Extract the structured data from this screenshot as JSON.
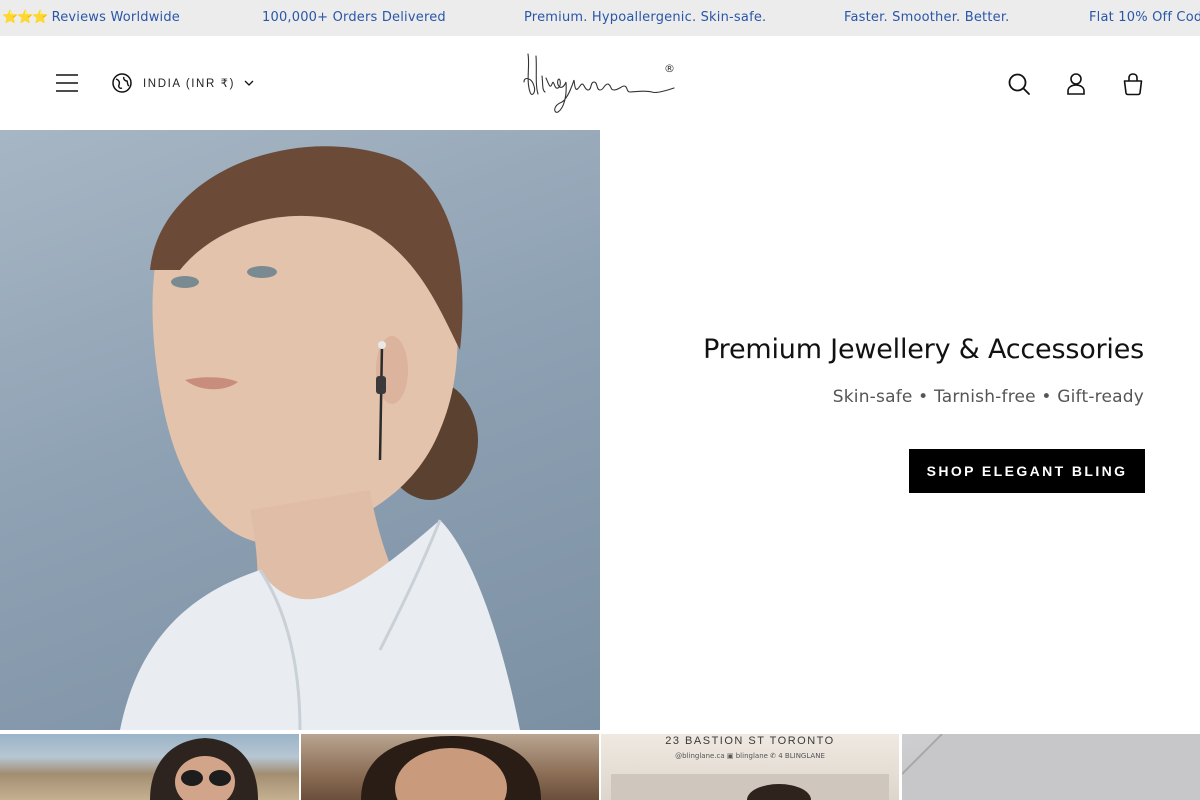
{
  "announcement": {
    "items": [
      {
        "stars": "⭐⭐⭐",
        "text": "Reviews Worldwide"
      },
      {
        "text": "100,000+ Orders Delivered"
      },
      {
        "text": "Premium. Hypoallergenic. Skin-safe."
      },
      {
        "text": "Faster. Smoother. Better."
      },
      {
        "text": "Flat 10% Off Cod"
      }
    ],
    "text_color": "#2a56a8",
    "background": "#ececec"
  },
  "header": {
    "locale_label": "INDIA (INR ₹)",
    "logo_text": "Blinglane",
    "logo_mark": "®",
    "icons": {
      "menu": "hamburger-menu-icon",
      "locale": "globe-icon",
      "locale_dropdown": "chevron-down-icon",
      "search": "search-icon",
      "account": "user-icon",
      "cart": "shopping-bag-icon"
    }
  },
  "hero": {
    "title": "Premium Jewellery & Accessories",
    "subtitle": "Skin-safe • Tarnish-free • Gift-ready",
    "cta_label": "SHOP ELEGANT BLING",
    "cta_color": "#000000"
  },
  "tiles": {
    "store_sign": "23 BASTION ST TORONTO",
    "store_sign_sub": "@blinglane.ca   ▣ blinglane   ✆ 4 BLINGLANE"
  }
}
